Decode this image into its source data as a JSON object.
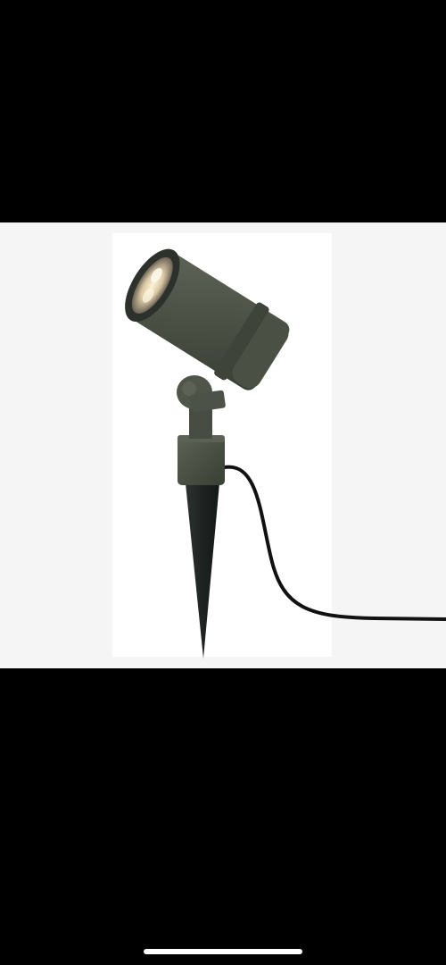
{
  "viewer": {
    "background": "#000000",
    "photo_background": "#f5f5f5",
    "home_indicator_color": "#ffffff"
  },
  "photo": {
    "subject": "spotlight-with-ground-stake",
    "body_color": "#4a5044",
    "stake_color": "#1f2322",
    "cable_color": "#111111"
  }
}
